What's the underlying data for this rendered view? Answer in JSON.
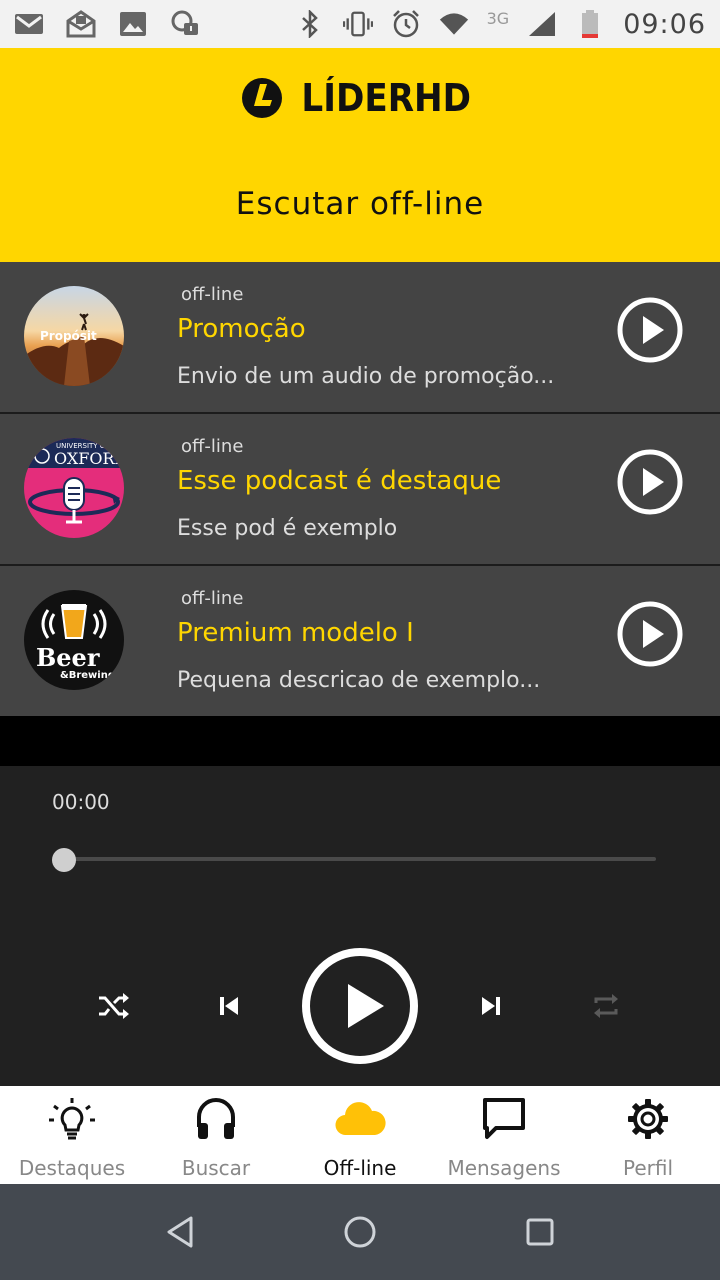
{
  "status_bar": {
    "time": "09:06",
    "network": "3G",
    "icons": [
      "gmail-icon",
      "email-icon",
      "image-icon",
      "screenshot-notification-icon",
      "bluetooth-icon",
      "vibrate-icon",
      "alarm-icon",
      "wifi-icon",
      "signal-icon",
      "battery-low-icon"
    ]
  },
  "header": {
    "logo_text": "LÍDERHD",
    "title": "Escutar off-line",
    "background": "#ffd600"
  },
  "podcasts": [
    {
      "status": "off-line",
      "title": "Promoção",
      "description": "Envio de um audio de promoção...",
      "thumb_label": "Propósit"
    },
    {
      "status": "off-line",
      "title": "Esse podcast é destaque",
      "description": "Esse pod é exemplo",
      "thumb_label_top": "UNIVERSITY OF",
      "thumb_label": "OXFORD"
    },
    {
      "status": "off-line",
      "title": "Premium modelo I",
      "description": "Pequena descricao de exemplo...",
      "thumb_label": "Beer",
      "thumb_label_small": "&Brewing"
    }
  ],
  "player": {
    "current_time": "00:00",
    "progress": 0,
    "controls": [
      "shuffle-icon",
      "previous-icon",
      "play-icon",
      "next-icon",
      "repeat-icon"
    ]
  },
  "bottom_nav": {
    "items": [
      {
        "label": "Destaques",
        "icon": "lightbulb-icon",
        "active": false
      },
      {
        "label": "Buscar",
        "icon": "headphones-icon",
        "active": false
      },
      {
        "label": "Off-line",
        "icon": "cloud-icon",
        "active": true
      },
      {
        "label": "Mensagens",
        "icon": "message-icon",
        "active": false
      },
      {
        "label": "Perfil",
        "icon": "gear-icon",
        "active": false
      }
    ]
  },
  "colors": {
    "accent": "#ffd600",
    "list_bg": "#444444",
    "player_bg": "#212121"
  }
}
